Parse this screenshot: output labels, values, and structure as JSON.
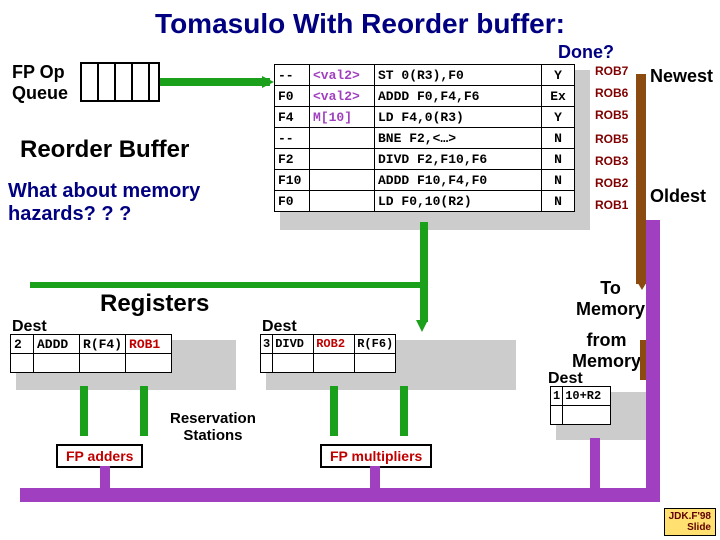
{
  "title": "Tomasulo With Reorder buffer:",
  "done_label": "Done?",
  "fp_queue_label": "FP Op\nQueue",
  "reorder_buffer_label": "Reorder Buffer",
  "question": "What about memory\nhazards? ? ?",
  "registers_label": "Registers",
  "newest_label": "Newest",
  "oldest_label": "Oldest",
  "to_memory": "To\nMemory",
  "from_memory": "from\nMemory",
  "dest_label": "Dest",
  "res_stations_label": "Reservation\nStations",
  "fp_adders_label": "FP adders",
  "fp_mult_label": "FP multipliers",
  "footer": "JDK.F'98\nSlide",
  "rob": [
    {
      "dest": "--",
      "val": "<val2>",
      "instr": "ST 0(R3),F0",
      "done": "Y",
      "tag": "ROB7"
    },
    {
      "dest": "F0",
      "val": "<val2>",
      "instr": "ADDD F0,F4,F6",
      "done": "Ex",
      "tag": "ROB6"
    },
    {
      "dest": "F4",
      "val": "M[10]",
      "instr": "LD F4,0(R3)",
      "done": "Y",
      "tag": "ROB5"
    },
    {
      "dest": "--",
      "val": "",
      "instr": "BNE F2,<…>",
      "done": "N",
      "tag": "ROB5"
    },
    {
      "dest": "F2",
      "val": "",
      "instr": "DIVD F2,F10,F6",
      "done": "N",
      "tag": "ROB3"
    },
    {
      "dest": "F10",
      "val": "",
      "instr": "ADDD F10,F4,F0",
      "done": "N",
      "tag": "ROB2"
    },
    {
      "dest": "F0",
      "val": "",
      "instr": "LD F0,10(R2)",
      "done": "N",
      "tag": "ROB1"
    }
  ],
  "reg_rs": {
    "tag": "2",
    "op": "ADDD",
    "s1": "R(F4)",
    "s2": "ROB1"
  },
  "mul_rs": {
    "tag": "3",
    "op": "DIVD",
    "s1": "ROB2",
    "s2": "R(F6)"
  },
  "ld_rs": {
    "tag": "1",
    "addr": "10+R2"
  }
}
